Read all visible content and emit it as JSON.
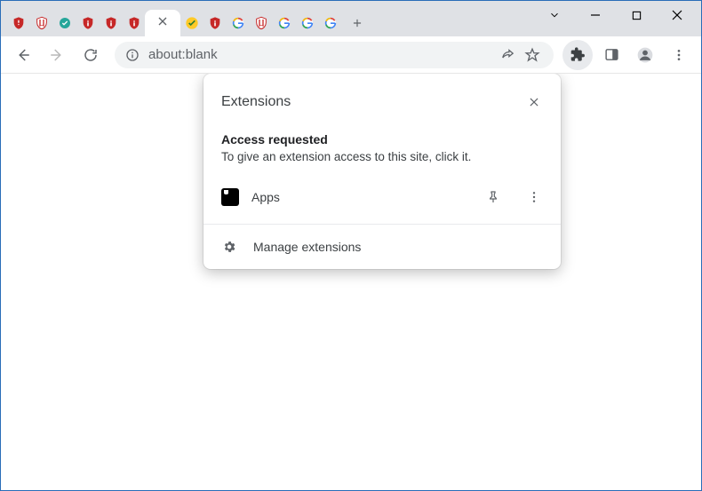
{
  "titlebar": {
    "tabs": [
      {
        "icon": "shield-red"
      },
      {
        "icon": "mcafee"
      },
      {
        "icon": "teal-check"
      },
      {
        "icon": "shield-red"
      },
      {
        "icon": "shield-red"
      },
      {
        "icon": "shield-red"
      },
      {
        "icon": "active"
      },
      {
        "icon": "norton-check"
      },
      {
        "icon": "shield-red"
      },
      {
        "icon": "google"
      },
      {
        "icon": "mcafee"
      },
      {
        "icon": "google"
      },
      {
        "icon": "google"
      },
      {
        "icon": "google"
      }
    ]
  },
  "toolbar": {
    "url": "about:blank"
  },
  "popup": {
    "title": "Extensions",
    "section_title": "Access requested",
    "section_sub": "To give an extension access to this site, click it.",
    "ext_name": "Apps",
    "manage_label": "Manage extensions"
  }
}
